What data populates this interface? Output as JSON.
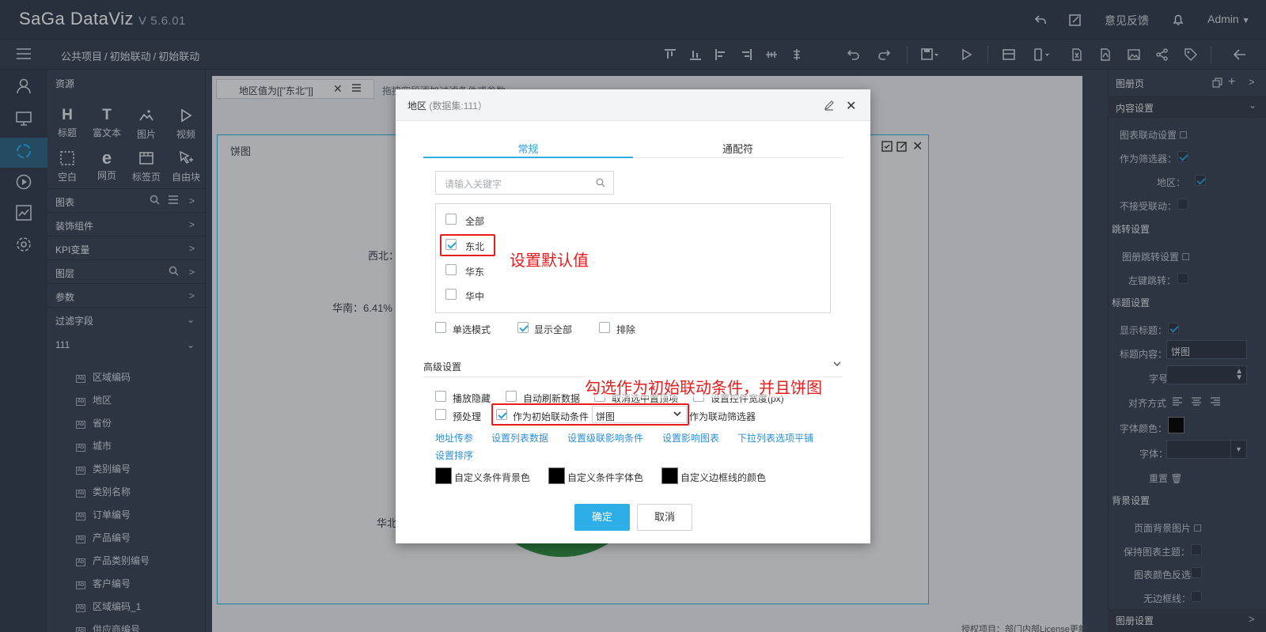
{
  "app": {
    "logo": "SaGa DataViz",
    "version": "V 5.6.01",
    "feedback": "意见反馈",
    "user": "Admin"
  },
  "breadcrumb": [
    "公共项目",
    "初始联动",
    "初始联动"
  ],
  "resources": {
    "title": "资源",
    "items": [
      {
        "icon": "H",
        "label": "标题"
      },
      {
        "icon": "T",
        "label": "富文本"
      },
      {
        "icon": "image-icon",
        "label": "图片"
      },
      {
        "icon": "play-icon",
        "label": "视频"
      },
      {
        "icon": "blank-icon",
        "label": "空白"
      },
      {
        "icon": "e",
        "label": "网页"
      },
      {
        "icon": "tabpage-icon",
        "label": "标签页"
      },
      {
        "icon": "freeblock-icon",
        "label": "自由块"
      }
    ],
    "sections": [
      "图表",
      "装饰组件",
      "KPI变量",
      "图层",
      "参数",
      "过滤字段"
    ],
    "dataset": "111",
    "fields": [
      "区域编码",
      "地区",
      "省份",
      "城市",
      "类别编号",
      "类别名称",
      "订单编号",
      "产品编号",
      "产品类别编号",
      "客户编号",
      "区域编码_1",
      "供应商编号"
    ]
  },
  "canvas": {
    "filter_text": "地区值为[[\"东北\"]]",
    "filter_hint": "拖拽字段添加过滤条件或参数",
    "chart_title": "饼图",
    "pie_labels": [
      "西北：",
      "华南：6.41%",
      "华北"
    ],
    "license": "授权项目：部门内部License更新"
  },
  "right_panel": {
    "title": "图册页",
    "content_settings": "内容设置",
    "chart_link_settings": "图表联动设置",
    "as_filter": "作为筛选器：",
    "region": "地区：",
    "no_link": "不接受联动：",
    "jump_settings": "跳转设置",
    "book_jump_settings": "图册跳转设置",
    "left_jump": "左键跳转：",
    "title_settings": "标题设置",
    "show_title": "显示标题：",
    "title_content_label": "标题内容：",
    "title_content_value": "饼图",
    "font_size": "字号",
    "align": "对齐方式",
    "font_color": "字体颜色：",
    "font": "字体：",
    "reset": "重置",
    "bg_settings": "背景设置",
    "bg_image": "页面背景图片",
    "keep_theme": "保持图表主题：",
    "color_invert": "图表颜色反选",
    "no_border": "无边框线：",
    "book_settings": "图册设置"
  },
  "modal": {
    "title": "地区",
    "subtitle": "(数据集:111）",
    "tabs": [
      "常规",
      "通配符"
    ],
    "search_placeholder": "请输入关键字",
    "options": [
      {
        "label": "全部",
        "checked": false
      },
      {
        "label": "东北",
        "checked": true
      },
      {
        "label": "华东",
        "checked": false
      },
      {
        "label": "华中",
        "checked": false
      }
    ],
    "annotation_default": "设置默认值",
    "single_select": "单选模式",
    "show_all": "显示全部",
    "exclude": "排除",
    "advanced": "高级设置",
    "annotation_link": "勾选作为初始联动条件，并且饼图",
    "adv_options": [
      "播放隐藏",
      "自动刷新数据",
      "取消选中置顶项",
      "设置控件宽度(px)",
      "预处理",
      "作为初始联动条件"
    ],
    "link_chart_value": "饼图",
    "as_link_filter": "作为联动筛选器",
    "links": [
      "地址传参",
      "设置列表数据",
      "设置级联影响条件",
      "设置影响图表",
      "下拉列表选项平铺",
      "设置排序"
    ],
    "colors": [
      "自定义条件背景色",
      "自定义条件字体色",
      "自定义边框线的颜色"
    ],
    "ok": "确定",
    "cancel": "取消"
  },
  "colors": {
    "accent": "#2eaee6",
    "annotation": "#e81c1c",
    "pie_green": "#2e8b3e"
  }
}
